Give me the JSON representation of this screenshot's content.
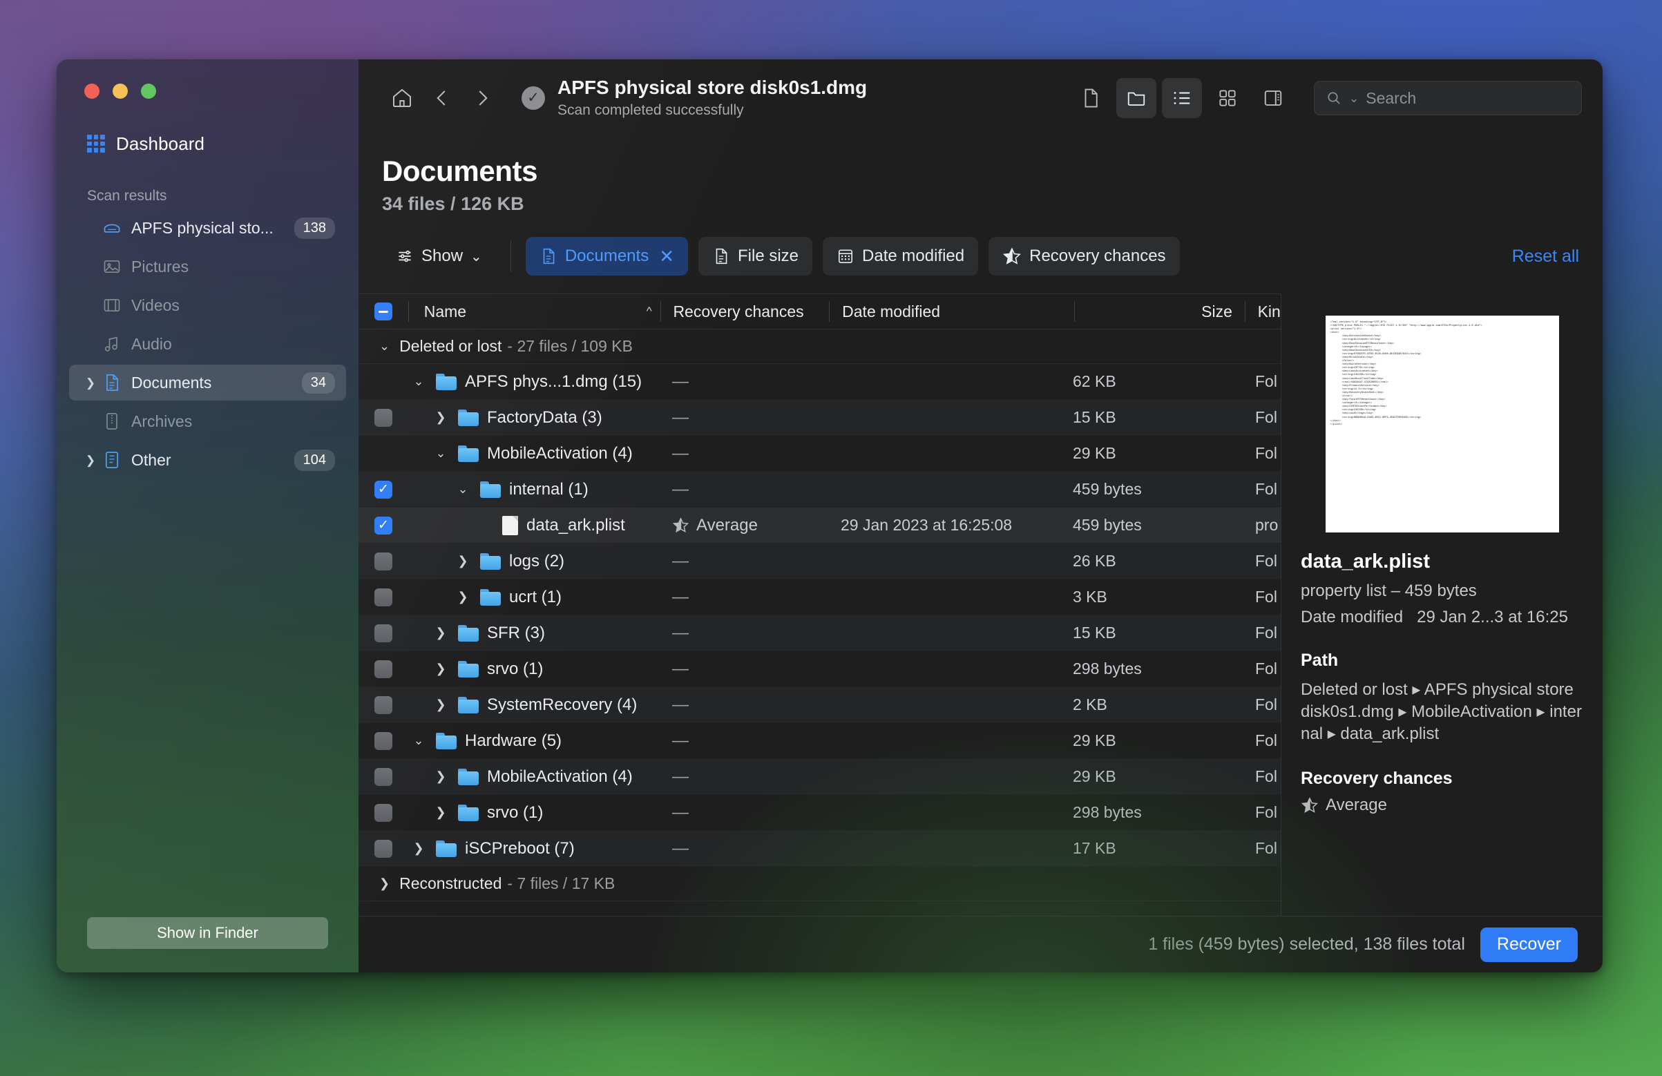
{
  "window": {
    "traffic_lights": [
      "close",
      "minimize",
      "zoom"
    ]
  },
  "sidebar": {
    "dashboard_label": "Dashboard",
    "section_label": "Scan results",
    "items": [
      {
        "label": "APFS physical sto...",
        "badge": "138",
        "icon": "disk-icon",
        "state": "normal",
        "expandable": false
      },
      {
        "label": "Pictures",
        "badge": "",
        "icon": "picture-icon",
        "state": "disabled",
        "expandable": false
      },
      {
        "label": "Videos",
        "badge": "",
        "icon": "video-icon",
        "state": "disabled",
        "expandable": false
      },
      {
        "label": "Audio",
        "badge": "",
        "icon": "audio-icon",
        "state": "disabled",
        "expandable": false
      },
      {
        "label": "Documents",
        "badge": "34",
        "icon": "document-icon",
        "state": "active",
        "expandable": true
      },
      {
        "label": "Archives",
        "badge": "",
        "icon": "archive-icon",
        "state": "disabled",
        "expandable": false
      },
      {
        "label": "Other",
        "badge": "104",
        "icon": "other-icon",
        "state": "normal",
        "expandable": true
      }
    ],
    "show_in_finder_label": "Show in Finder"
  },
  "toolbar": {
    "home_icon": "home-icon",
    "back_icon": "chevron-left-icon",
    "forward_icon": "chevron-right-icon",
    "scan_title": "APFS physical store disk0s1.dmg",
    "scan_subtitle": "Scan completed successfully",
    "view_buttons": [
      {
        "name": "file-view-button",
        "icon": "file-icon",
        "active": false
      },
      {
        "name": "folder-view-button",
        "icon": "folder-icon",
        "active": true
      },
      {
        "name": "list-view-button",
        "icon": "list-icon",
        "active": true
      },
      {
        "name": "grid-view-button",
        "icon": "grid-icon",
        "active": false
      },
      {
        "name": "sidebar-toggle-button",
        "icon": "panel-icon",
        "active": false
      }
    ],
    "search_placeholder": "Search"
  },
  "content": {
    "title": "Documents",
    "subtitle": "34 files / 126 KB"
  },
  "filters": {
    "show_label": "Show",
    "chips": [
      {
        "label": "Documents",
        "icon": "document-icon",
        "selected": true,
        "closable": true
      },
      {
        "label": "File size",
        "icon": "file-icon",
        "selected": false,
        "closable": false
      },
      {
        "label": "Date modified",
        "icon": "calendar-icon",
        "selected": false,
        "closable": false
      },
      {
        "label": "Recovery chances",
        "icon": "star-icon",
        "selected": false,
        "closable": false
      }
    ],
    "reset_label": "Reset all"
  },
  "table": {
    "columns": [
      "Name",
      "Recovery chances",
      "Date modified",
      "Size",
      "Kind"
    ],
    "sort_indicator": "ascending",
    "header_checkbox": "mixed",
    "groups": [
      {
        "label": "Deleted or lost",
        "meta": "- 27 files / 109 KB",
        "expanded": true
      },
      {
        "label": "Reconstructed",
        "meta": "- 7 files / 17 KB",
        "expanded": false
      }
    ],
    "rows": [
      {
        "name": "APFS phys...1.dmg (15)",
        "indent": 0,
        "twisty": "down",
        "type": "folder",
        "check": "mixed",
        "recovery": "",
        "date": "",
        "size": "62 KB",
        "kind": "Fol",
        "selected": false
      },
      {
        "name": "FactoryData (3)",
        "indent": 1,
        "twisty": "right",
        "type": "folder",
        "check": "off",
        "recovery": "",
        "date": "",
        "size": "15 KB",
        "kind": "Fol",
        "selected": false
      },
      {
        "name": "MobileActivation (4)",
        "indent": 1,
        "twisty": "down",
        "type": "folder",
        "check": "mixed",
        "recovery": "",
        "date": "",
        "size": "29 KB",
        "kind": "Fol",
        "selected": false
      },
      {
        "name": "internal (1)",
        "indent": 2,
        "twisty": "down",
        "type": "folder",
        "check": "on",
        "recovery": "",
        "date": "",
        "size": "459 bytes",
        "kind": "Fol",
        "selected": false
      },
      {
        "name": "data_ark.plist",
        "indent": 3,
        "twisty": "none",
        "type": "file",
        "check": "on",
        "recovery": "Average",
        "date": "29 Jan 2023 at 16:25:08",
        "size": "459 bytes",
        "kind": "pro",
        "selected": true
      },
      {
        "name": "logs (2)",
        "indent": 2,
        "twisty": "right",
        "type": "folder",
        "check": "off",
        "recovery": "",
        "date": "",
        "size": "26 KB",
        "kind": "Fol",
        "selected": false
      },
      {
        "name": "ucrt (1)",
        "indent": 2,
        "twisty": "right",
        "type": "folder",
        "check": "off",
        "recovery": "",
        "date": "",
        "size": "3 KB",
        "kind": "Fol",
        "selected": false
      },
      {
        "name": "SFR (3)",
        "indent": 1,
        "twisty": "right",
        "type": "folder",
        "check": "off",
        "recovery": "",
        "date": "",
        "size": "15 KB",
        "kind": "Fol",
        "selected": false
      },
      {
        "name": "srvo (1)",
        "indent": 1,
        "twisty": "right",
        "type": "folder",
        "check": "off",
        "recovery": "",
        "date": "",
        "size": "298 bytes",
        "kind": "Fol",
        "selected": false
      },
      {
        "name": "SystemRecovery (4)",
        "indent": 1,
        "twisty": "right",
        "type": "folder",
        "check": "off",
        "recovery": "",
        "date": "",
        "size": "2 KB",
        "kind": "Fol",
        "selected": false
      },
      {
        "name": "Hardware (5)",
        "indent": 0,
        "twisty": "down",
        "type": "folder",
        "check": "off",
        "recovery": "",
        "date": "",
        "size": "29 KB",
        "kind": "Fol",
        "selected": false
      },
      {
        "name": "MobileActivation (4)",
        "indent": 1,
        "twisty": "right",
        "type": "folder",
        "check": "off",
        "recovery": "",
        "date": "",
        "size": "29 KB",
        "kind": "Fol",
        "selected": false
      },
      {
        "name": "srvo (1)",
        "indent": 1,
        "twisty": "right",
        "type": "folder",
        "check": "off",
        "recovery": "",
        "date": "",
        "size": "298 bytes",
        "kind": "Fol",
        "selected": false
      },
      {
        "name": "iSCPreboot (7)",
        "indent": 0,
        "twisty": "right",
        "type": "folder",
        "check": "off",
        "recovery": "",
        "date": "",
        "size": "17 KB",
        "kind": "Fol",
        "selected": false
      }
    ],
    "empty_cell": "—"
  },
  "preview": {
    "thumbnail_text": "<?xml version=\"1.0\" encoding=\"UTF-8\"?>\n<!DOCTYPE plist PUBLIC \"-//Apple//DTD PLIST 1.0//EN\" \"http://www.apple.com/DTDs/PropertyList-1.0.dtd\">\n<plist version=\"1.0\">\n<dict>\n        <key>ActivationState</key>\n        <string>Activated</string>\n        <key>BootSessionRTCResetCount</key>\n        <integer>0</integer>\n        <key>BootSessionUUID</key>\n        <string>075B2CFC-8FE9-4528-8408-AE13D9957644</string>\n        <key>BrickState</key>\n        <false/>\n        <key>BuildVersion</key>\n        <string>22F76</string>\n        <key>LastActivated</key>\n        <string>21E230</string>\n        <key>LastBootClockTime</key>\n        <real>44828447.979520855</real>\n        <key>ProductVersion</key>\n        <string>14.5</string>\n        <key>RecoveryStateSent</key>\n        <true/>\n        <key>TotalRTCResetCount</key>\n        <integer>4</integer>\n        <key>UCRTUDLastPerformed</key>\n        <string>21E230</string>\n        <key>uniStrings</key>\n        <string>6BAD801A-EA93-4EE2-8EF9-4EA27D0F6465</string>\n</dict>\n</plist>",
    "file_name": "data_ark.plist",
    "kind_size": "property list – 459 bytes",
    "date_label": "Date modified",
    "date_value": "29 Jan 2...3 at 16:25",
    "path_heading": "Path",
    "path_value": "Deleted or lost ▸ APFS physical store disk0s1.dmg ▸ MobileActivation ▸ internal ▸ data_ark.plist",
    "recovery_heading": "Recovery chances",
    "recovery_value": "Average"
  },
  "status": {
    "text": "1 files (459 bytes) selected, 138 files total",
    "recover_label": "Recover"
  }
}
